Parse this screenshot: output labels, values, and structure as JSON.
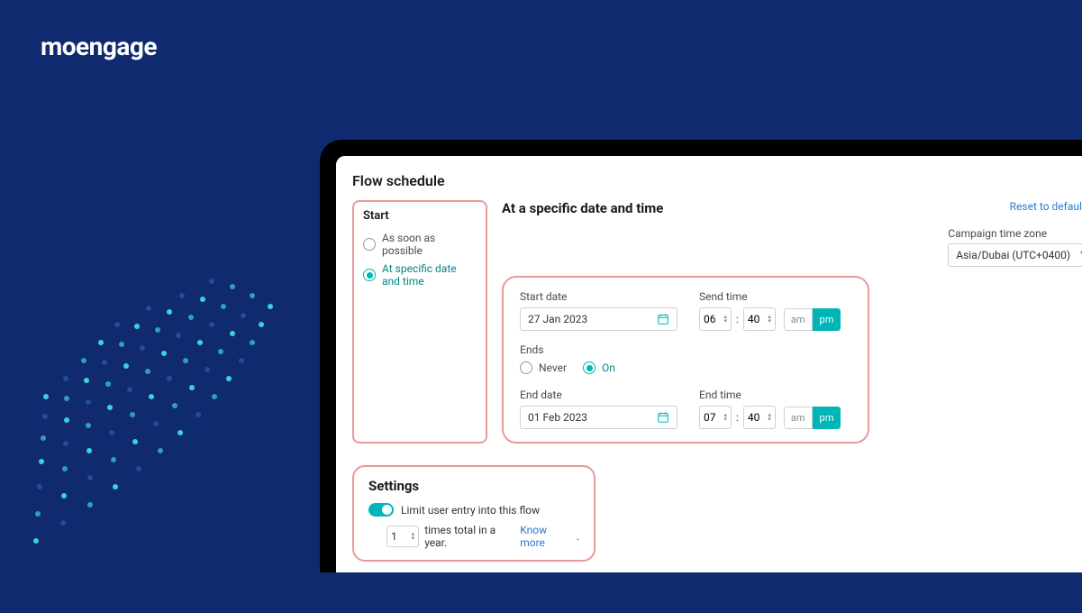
{
  "brand": {
    "name": "moengage"
  },
  "page_title": "Flow schedule",
  "start_panel": {
    "label": "Start",
    "options": [
      {
        "label": "As soon as possible",
        "selected": false
      },
      {
        "label": "At specific date and time",
        "selected": true
      }
    ]
  },
  "main": {
    "title": "At a specific date and time",
    "reset_label": "Reset to defaults",
    "timezone": {
      "label": "Campaign time zone",
      "value": "Asia/Dubai (UTC+0400)"
    },
    "start_date": {
      "label": "Start date",
      "value": "27 Jan 2023"
    },
    "send_time": {
      "label": "Send time",
      "hour": "06",
      "minute": "40",
      "am": "am",
      "pm": "pm"
    },
    "ends": {
      "label": "Ends",
      "options": [
        {
          "label": "Never",
          "selected": false
        },
        {
          "label": "On",
          "selected": true
        }
      ]
    },
    "end_date": {
      "label": "End date",
      "value": "01 Feb 2023"
    },
    "end_time": {
      "label": "End time",
      "hour": "07",
      "minute": "40",
      "am": "am",
      "pm": "pm"
    }
  },
  "settings": {
    "title": "Settings",
    "toggle_label": "Limit user entry into this flow",
    "limit_value": "1",
    "limit_suffix": "times total in a year.",
    "know_more": "Know more"
  }
}
